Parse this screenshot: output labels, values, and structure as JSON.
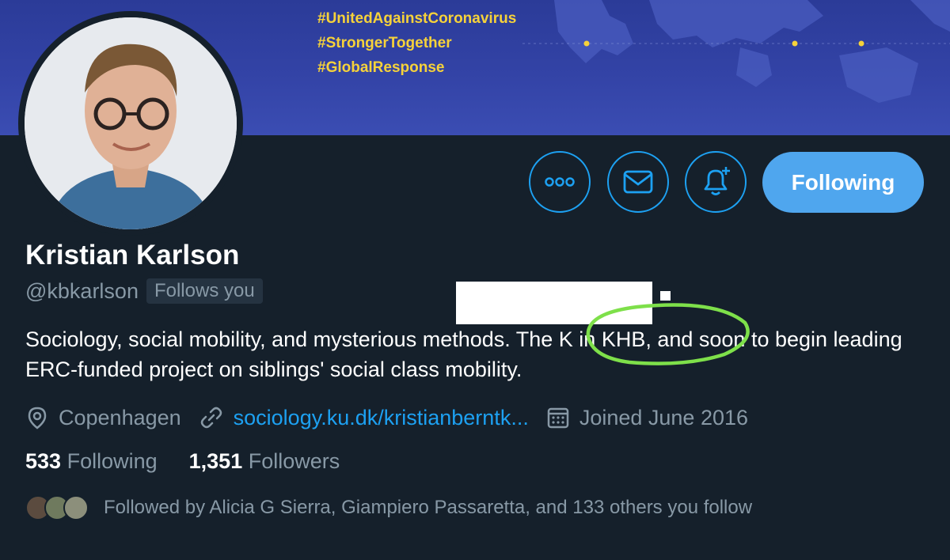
{
  "banner": {
    "hashtags": [
      "#UnitedAgainstCoronavirus",
      "#StrongerTogether",
      "#GlobalResponse"
    ],
    "background_color": "#3343a6",
    "hashtag_color": "#f6d23a"
  },
  "profile": {
    "name": "Kristian Karlson",
    "handle": "@kbkarlson",
    "follows_you_badge": "Follows you",
    "bio": "Sociology, social mobility, and mysterious methods. The K in KHB, and soon to begin leading ERC-funded project on siblings' social class mobility.",
    "location": "Copenhagen",
    "website": "sociology.ku.dk/kristianberntk...",
    "joined": "Joined June 2016"
  },
  "actions": {
    "more_icon": "more-horizontal-icon",
    "message_icon": "mail-icon",
    "notify_icon": "bell-plus-icon",
    "follow_label": "Following"
  },
  "stats": {
    "following_count": "533",
    "following_label": "Following",
    "followers_count": "1,351",
    "followers_label": "Followers"
  },
  "followed_by": {
    "text": "Followed by Alicia G Sierra, Giampiero Passaretta, and 133 others you follow"
  },
  "colors": {
    "background": "#15202b",
    "accent": "#1da1f2",
    "follow_button": "#4fa6ee",
    "secondary_text": "#8899a6",
    "annotation": "#7ee04a"
  }
}
